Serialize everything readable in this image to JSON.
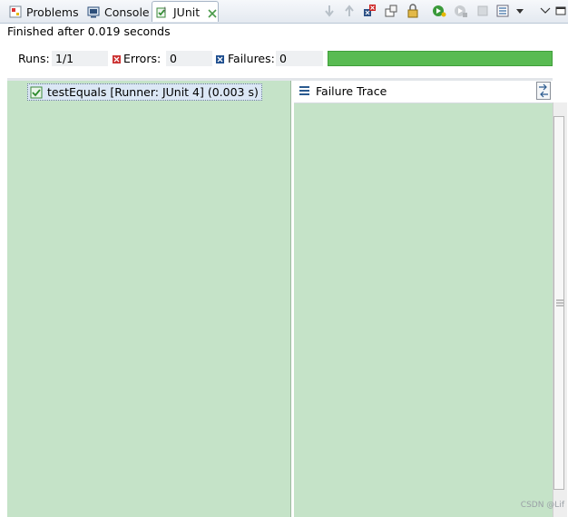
{
  "tabs": [
    {
      "label": "Problems",
      "icon": "problems-icon"
    },
    {
      "label": "Console",
      "icon": "console-icon"
    },
    {
      "label": "JUnit",
      "icon": "junit-icon",
      "active": true
    }
  ],
  "toolbar": {
    "icons": [
      "next-failure-icon",
      "previous-failure-icon",
      "show-failures-only-icon",
      "scroll-lock-icon",
      "lock-icon",
      "rerun-test-icon",
      "rerun-failed-first-icon",
      "stop-icon",
      "test-history-icon",
      "dropdown-arrow-icon",
      "minimize-icon",
      "maximize-icon"
    ]
  },
  "status": {
    "text": "Finished after 0.019 seconds"
  },
  "counters": {
    "runs_label": "Runs:",
    "runs_value": "1/1",
    "errors_label": "Errors:",
    "errors_value": "0",
    "failures_label": "Failures:",
    "failures_value": "0"
  },
  "progress": {
    "fraction": 1.0,
    "color": "#59bb52"
  },
  "tree": {
    "items": [
      {
        "label": "testEquals [Runner: JUnit 4] (0.003 s)",
        "icon": "test-passed-icon"
      }
    ]
  },
  "trace": {
    "title": "Failure Trace"
  },
  "watermark": "CSDN @Lif",
  "colors": {
    "pane_bg": "#c5e3c8",
    "progress": "#59bb52",
    "error": "#cc3333",
    "failure": "#1f4f8f"
  }
}
